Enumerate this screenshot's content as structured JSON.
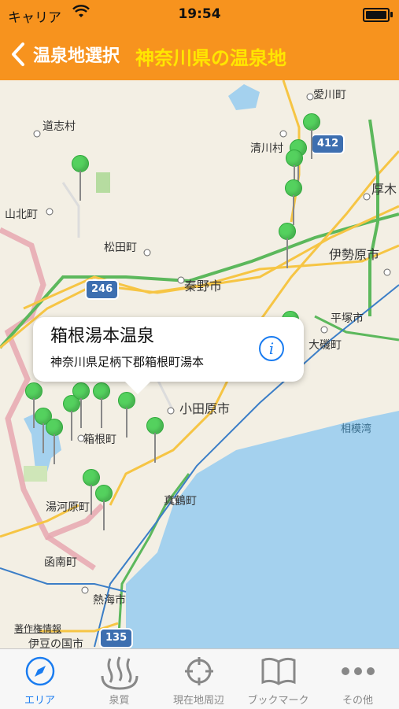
{
  "status_bar": {
    "carrier": "キャリア",
    "time": "19:54"
  },
  "nav": {
    "back_label": "温泉地選択",
    "title": "神奈川県の温泉地"
  },
  "map": {
    "places": [
      "愛川町",
      "道志村",
      "清川村",
      "厚木",
      "山北町",
      "松田町",
      "伊勢原市",
      "秦野市",
      "平塚市",
      "大磯町",
      "小田原市",
      "箱根町",
      "相模湾",
      "湯河原町",
      "真鶴町",
      "函南町",
      "熱海市",
      "伊豆の国市"
    ],
    "route_shields": [
      "412",
      "246",
      "135"
    ],
    "legal": "著作権情報"
  },
  "callout": {
    "title": "箱根湯本温泉",
    "address": "神奈川県足柄下郡箱根町湯本"
  },
  "tabs": [
    {
      "label": "エリア",
      "icon": "compass-icon"
    },
    {
      "label": "泉質",
      "icon": "hot-spring-icon"
    },
    {
      "label": "現在地周辺",
      "icon": "location-target-icon"
    },
    {
      "label": "ブックマーク",
      "icon": "book-icon"
    },
    {
      "label": "その他",
      "icon": "more-icon"
    }
  ],
  "colors": {
    "accent": "#f7931e",
    "title": "#ffe600",
    "pin": "#54d15e",
    "tab_active": "#1a7cf0"
  }
}
